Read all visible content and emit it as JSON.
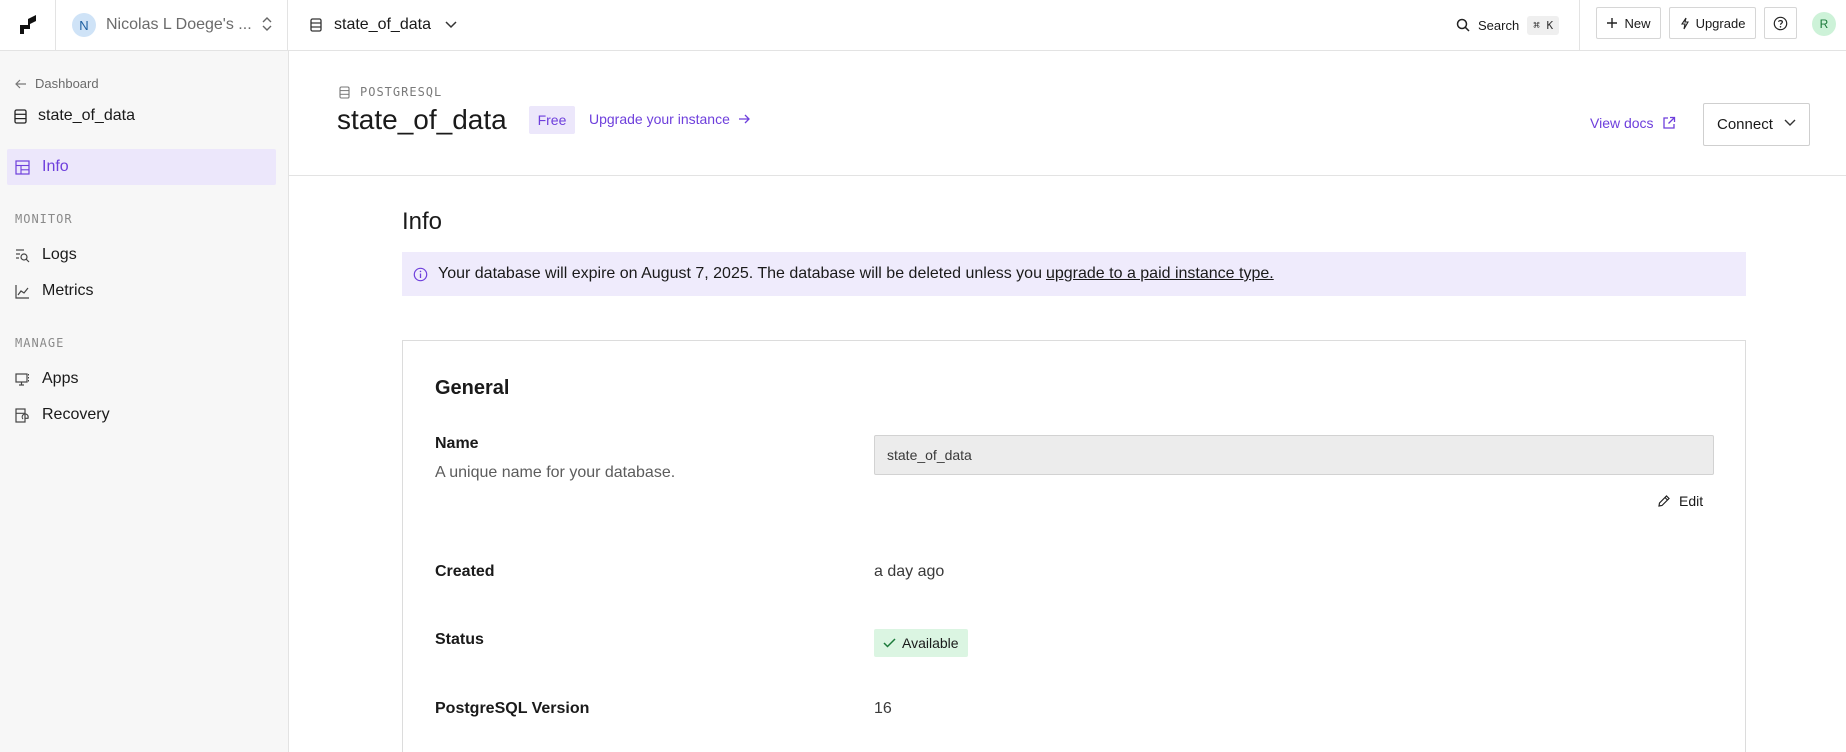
{
  "topbar": {
    "workspace_initial": "N",
    "workspace_name": "Nicolas L Doege's ...",
    "database_name": "state_of_data",
    "search_label": "Search",
    "search_shortcut": "⌘ K",
    "new_label": "New",
    "upgrade_label": "Upgrade",
    "user_initial": "R"
  },
  "sidebar": {
    "back_label": "Dashboard",
    "database_name": "state_of_data",
    "active_item": "Info",
    "sections": [
      {
        "title": "MONITOR",
        "items": [
          "Logs",
          "Metrics"
        ]
      },
      {
        "title": "MANAGE",
        "items": [
          "Apps",
          "Recovery"
        ]
      }
    ]
  },
  "header": {
    "engine": "POSTGRESQL",
    "title": "state_of_data",
    "plan_badge": "Free",
    "upgrade_link": "Upgrade your instance",
    "view_docs": "View docs",
    "connect_label": "Connect"
  },
  "content": {
    "page_title": "Info",
    "banner_text": "Your database will expire on August 7, 2025. The database will be deleted unless you",
    "banner_link": "upgrade to a paid instance type.",
    "general": {
      "title": "General",
      "name_label": "Name",
      "name_description": "A unique name for your database.",
      "name_value": "state_of_data",
      "edit_label": "Edit",
      "created_label": "Created",
      "created_value": "a day ago",
      "status_label": "Status",
      "status_value": "Available",
      "version_label": "PostgreSQL Version",
      "version_value": "16"
    }
  },
  "colors": {
    "accent": "#6e3fdc",
    "accent_bg": "#ece7fb",
    "success_bg": "#dbf5e2"
  }
}
